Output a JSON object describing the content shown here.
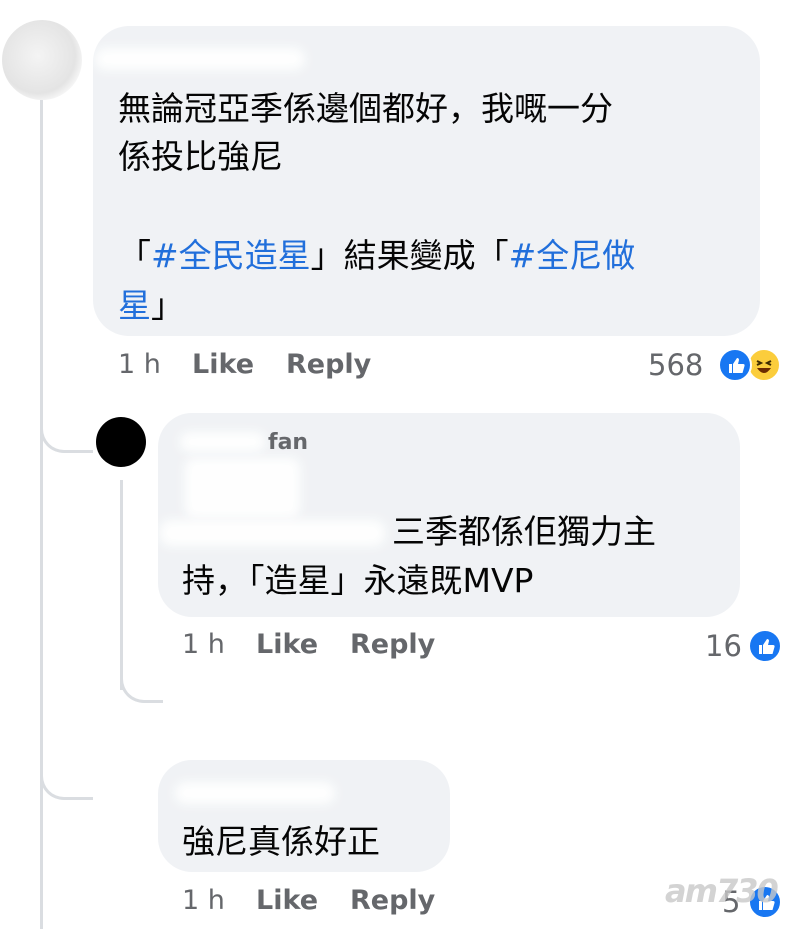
{
  "comments": [
    {
      "author": "",
      "lines": [
        "無論冠亞季係邊個都好，我嘅一分",
        "係投比強尼"
      ],
      "hashtag_line_1": {
        "open": "「",
        "tag": "#全民造星",
        "mid": "」結果變成「",
        "tag2": "#全尼做"
      },
      "hashtag_line_2": {
        "tag": "星",
        "close": "」"
      },
      "time": "1 h",
      "like": "Like",
      "reply": "Reply",
      "reaction_count": "568",
      "reaction_icons": [
        "like-icon",
        "haha-icon"
      ]
    },
    {
      "author_suffix": "fan",
      "line1_tail": "三季都係佢獨力主",
      "line2": "持，「造星」永遠既MVP",
      "time": "1 h",
      "like": "Like",
      "reply": "Reply",
      "reaction_count": "16",
      "reaction_icons": [
        "like-icon"
      ]
    },
    {
      "line1": "強尼真係好正",
      "time": "1 h",
      "like": "Like",
      "reply": "Reply",
      "reaction_count": "5",
      "reaction_icons": [
        "like-icon"
      ]
    }
  ],
  "watermark": "am730",
  "colors": {
    "bubble": "#f0f2f5",
    "link": "#216fdb",
    "meta": "#65676b",
    "like": "#1877f2"
  }
}
